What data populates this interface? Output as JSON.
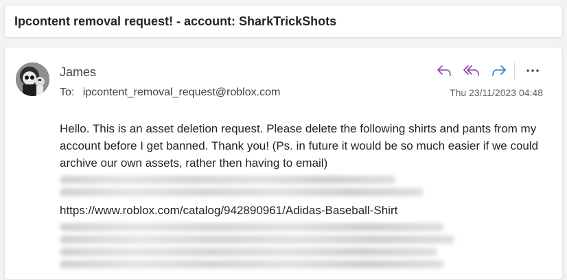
{
  "subject": "Ipcontent removal request! - account: SharkTrickShots",
  "message": {
    "sender": "James",
    "to_label": "To:",
    "to_address": "ipcontent_removal_request@roblox.com",
    "timestamp": "Thu 23/11/2023 04:48",
    "body_text": "Hello. This is an asset deletion request. Please delete the following shirts and pants from my account before I get banned. Thank you! (Ps. in future it would be so much easier if we could archive our own assets, rather then having to email)",
    "visible_link": "https://www.roblox.com/catalog/942890961/Adidas-Baseball-Shirt"
  },
  "icons": {
    "reply": "reply-icon",
    "reply_all": "reply-all-icon",
    "forward": "forward-icon",
    "more": "more-icon"
  },
  "colors": {
    "reply_icon": "#8b3fa8",
    "forward_icon": "#2b7cd3"
  }
}
